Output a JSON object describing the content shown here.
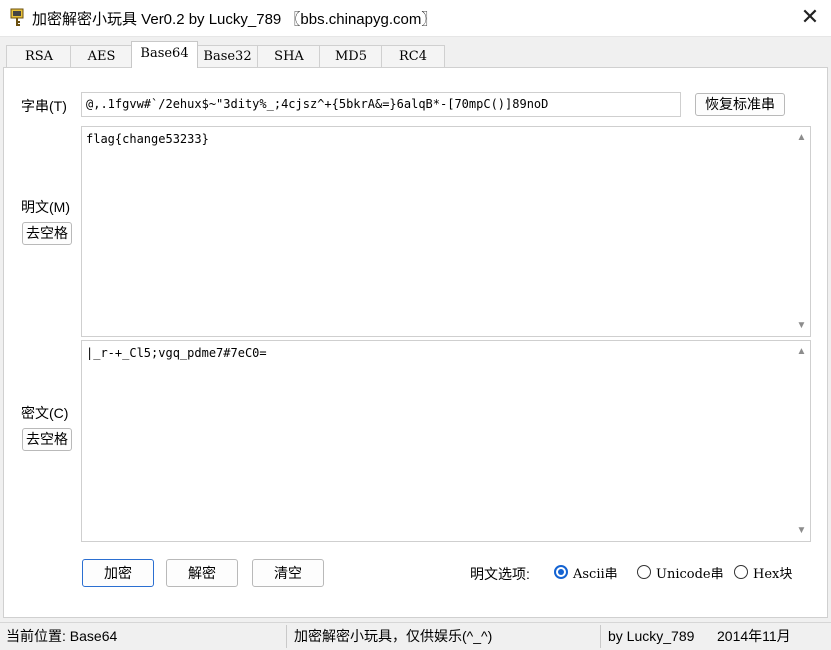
{
  "window": {
    "title": "加密解密小玩具 Ver0.2 by Lucky_789 〖bbs.chinapyg.com〗",
    "close_glyph": "✕"
  },
  "tabs": [
    {
      "label": "RSA"
    },
    {
      "label": "AES"
    },
    {
      "label": "Base64",
      "active": true
    },
    {
      "label": "Base32"
    },
    {
      "label": "SHA"
    },
    {
      "label": "MD5"
    },
    {
      "label": "RC4"
    }
  ],
  "alphabet": {
    "label": "字串(T)",
    "value": "@,.1fgvw#`/2ehux$~\"3dity%_;4cjsz^+{5bkrA&=}6alqB*-[70mpC()]89noD",
    "restore_button": "恢复标准串"
  },
  "plaintext": {
    "label": "明文(M)",
    "value": "flag{change53233}",
    "strip_button": "去空格"
  },
  "ciphertext": {
    "label": "密文(C)",
    "value": "|_r-+_Cl5;vgq_pdme7#7eC0=",
    "strip_button": "去空格"
  },
  "actions": {
    "encrypt": "加密",
    "decrypt": "解密",
    "clear": "清空"
  },
  "options": {
    "label": "明文选项:",
    "items": [
      {
        "label": "Ascii串",
        "selected": true
      },
      {
        "label": "Unicode串",
        "selected": false
      },
      {
        "label": "Hex块",
        "selected": false
      }
    ]
  },
  "status": {
    "position": "当前位置: Base64",
    "note": "加密解密小玩具，仅供娱乐(^_^)",
    "author": "by Lucky_789",
    "date": "2014年11月"
  },
  "colors": {
    "accent": "#1463d2",
    "button_border_focus": "#2b6fd1"
  },
  "icons": {
    "app": "key-lock-icon",
    "scroll_up": "triangle-up-icon",
    "scroll_down": "triangle-down-icon"
  }
}
